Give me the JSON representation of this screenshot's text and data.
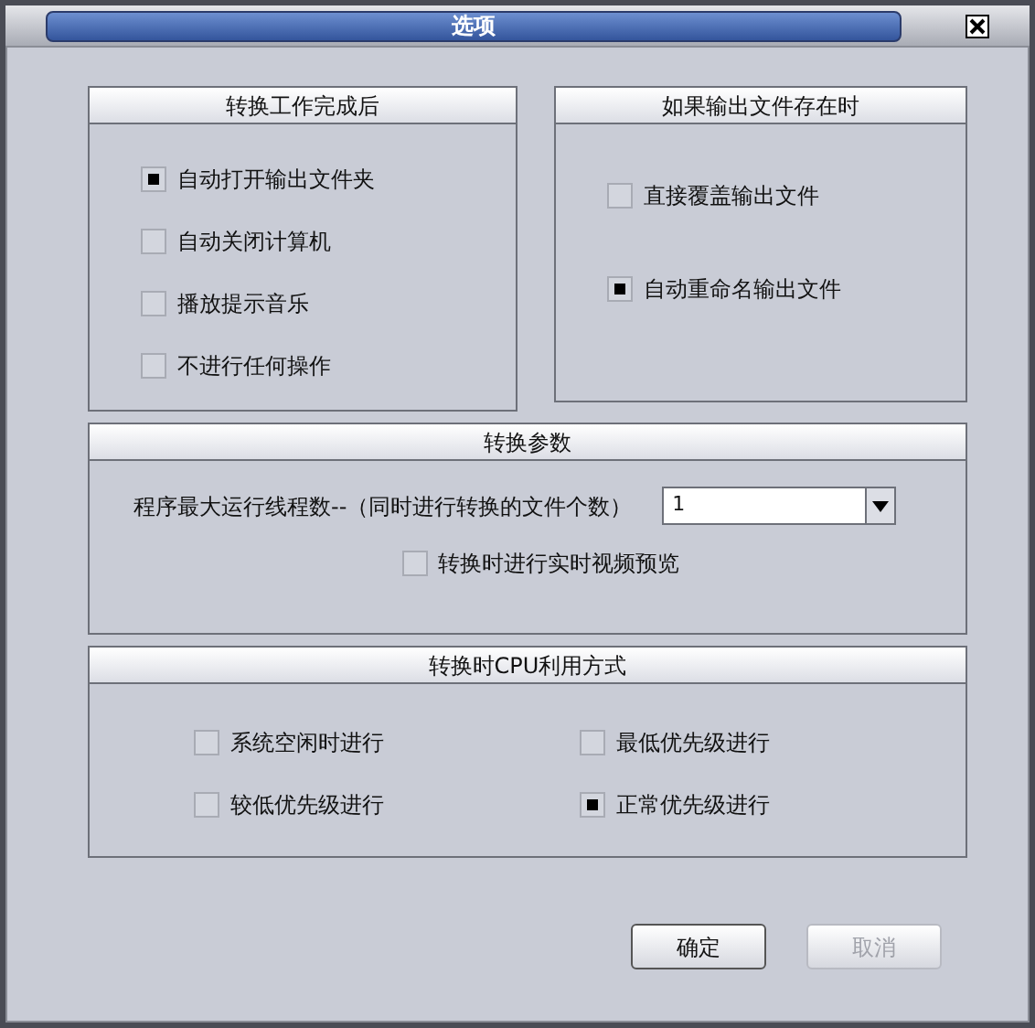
{
  "window": {
    "title": "选项"
  },
  "after_conversion": {
    "title": "转换工作完成后",
    "options": [
      {
        "label": "自动打开输出文件夹",
        "checked": true
      },
      {
        "label": "自动关闭计算机",
        "checked": false
      },
      {
        "label": "播放提示音乐",
        "checked": false
      },
      {
        "label": "不进行任何操作",
        "checked": false
      }
    ]
  },
  "if_output_exists": {
    "title": "如果输出文件存在时",
    "options": [
      {
        "label": "直接覆盖输出文件",
        "checked": false
      },
      {
        "label": "自动重命名输出文件",
        "checked": true
      }
    ]
  },
  "conversion_params": {
    "title": "转换参数",
    "threads_label": "程序最大运行线程数--（同时进行转换的文件个数）",
    "threads_value": "1",
    "preview": {
      "label": "转换时进行实时视频预览",
      "checked": false
    }
  },
  "cpu_usage": {
    "title": "转换时CPU利用方式",
    "options": [
      {
        "label": "系统空闲时进行",
        "checked": false
      },
      {
        "label": "最低优先级进行",
        "checked": false
      },
      {
        "label": "较低优先级进行",
        "checked": false
      },
      {
        "label": "正常优先级进行",
        "checked": true
      }
    ]
  },
  "buttons": [
    {
      "label": "确定",
      "disabled": false
    },
    {
      "label": "取消",
      "disabled": true
    }
  ]
}
